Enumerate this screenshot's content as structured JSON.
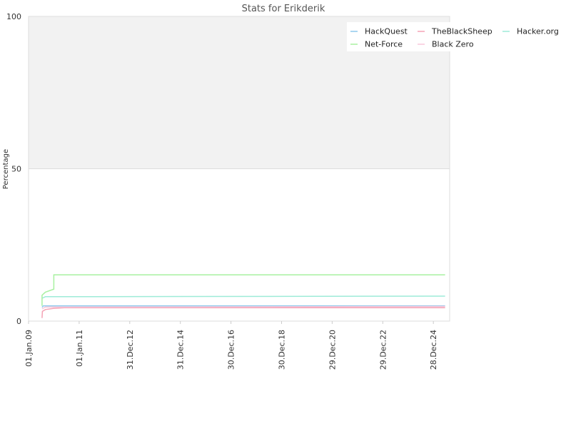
{
  "chart_data": {
    "type": "line",
    "title": "Stats for Erikderik",
    "xlabel": "",
    "ylabel": "Percentage",
    "ylim": [
      0,
      100
    ],
    "yticks": [
      "0",
      "50",
      "100"
    ],
    "xticks": [
      "01.Jan.09",
      "01.Jan.11",
      "31.Dec.12",
      "31.Dec.14",
      "30.Dec.16",
      "30.Dec.18",
      "29.Dec.20",
      "29.Dec.22",
      "28.Dec.24"
    ],
    "xlim": [
      "2009-01-01",
      "2025-08-20"
    ],
    "grid": true,
    "shaded_band": [
      50,
      100
    ],
    "legend_position": "top-right",
    "series": [
      {
        "name": "HackQuest",
        "color": "#8fc8ec",
        "points": [
          [
            "2009-07-15",
            4.5
          ],
          [
            "2009-08-01",
            5.0
          ],
          [
            "2025-06-15",
            5.0
          ]
        ]
      },
      {
        "name": "TheBlackSheep",
        "color": "#f4a3b5",
        "points": [
          [
            "2009-07-15",
            1.0
          ],
          [
            "2009-07-20",
            3.2
          ],
          [
            "2009-09-01",
            3.8
          ],
          [
            "2010-01-01",
            4.2
          ],
          [
            "2010-06-01",
            4.4
          ],
          [
            "2025-06-15",
            4.4
          ]
        ]
      },
      {
        "name": "Hacker.org",
        "color": "#9eebd8",
        "points": [
          [
            "2009-07-15",
            7.5
          ],
          [
            "2009-09-01",
            8.0
          ],
          [
            "2025-06-15",
            8.2
          ]
        ]
      },
      {
        "name": "Net-Force",
        "color": "#a8f0a0",
        "points": [
          [
            "2009-07-15",
            5.0
          ],
          [
            "2009-07-15",
            8.5
          ],
          [
            "2009-09-01",
            9.5
          ],
          [
            "2010-01-01",
            10.5
          ],
          [
            "2010-01-01",
            15.2
          ],
          [
            "2025-06-15",
            15.2
          ]
        ]
      },
      {
        "name": "Black Zero",
        "color": "#f9c7da",
        "points": [
          [
            "2009-07-15",
            4.0
          ],
          [
            "2009-09-01",
            4.6
          ],
          [
            "2025-06-15",
            4.8
          ]
        ]
      }
    ]
  }
}
